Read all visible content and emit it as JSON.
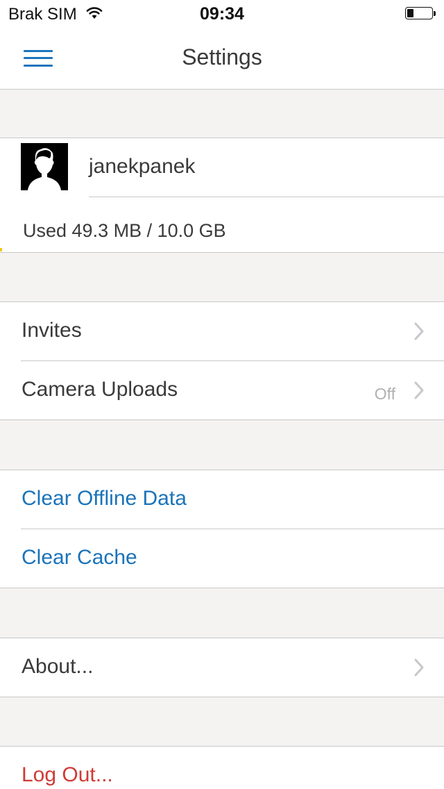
{
  "status_bar": {
    "carrier": "Brak SIM",
    "time": "09:34",
    "battery_level": 0.25
  },
  "nav": {
    "title": "Settings"
  },
  "account": {
    "username": "janekpanek",
    "usage": "Used 49.3 MB / 10.0 GB"
  },
  "sections": {
    "invites": {
      "label": "Invites"
    },
    "camera_uploads": {
      "label": "Camera Uploads",
      "value": "Off"
    },
    "clear_offline": {
      "label": "Clear Offline Data"
    },
    "clear_cache": {
      "label": "Clear Cache"
    },
    "about": {
      "label": "About..."
    },
    "logout": {
      "label": "Log Out..."
    }
  },
  "colors": {
    "accent": "#1d75bd",
    "action_text": "#1a73b9",
    "destructive": "#cf3a35",
    "group_background": "#f4f3f2",
    "separator": "#c8c8c8"
  }
}
